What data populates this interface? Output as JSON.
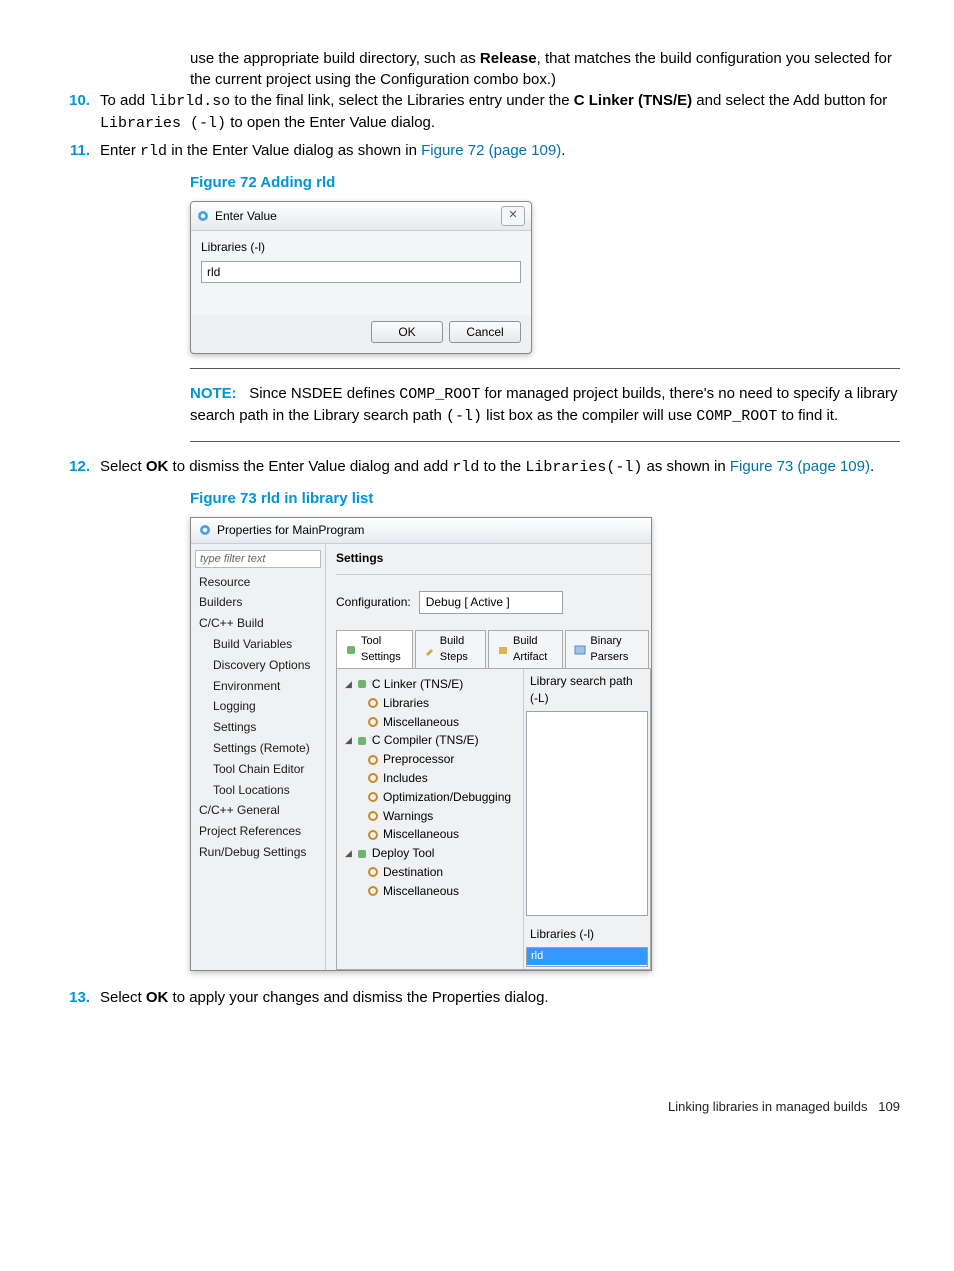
{
  "para0": {
    "pre": "use the appropriate build directory, such as ",
    "bold": "Release",
    "post": ", that matches the build configuration you selected for the current project using the Configuration combo box.)"
  },
  "step10": {
    "num": "10.",
    "t1": "To add ",
    "code1": "librld.so",
    "t2": " to the final link, select the Libraries entry under the ",
    "bold1": "C Linker (TNS/E)",
    "t3": " and select the Add button for ",
    "code2": "Libraries (-l)",
    "t4": " to open the Enter Value dialog."
  },
  "step11": {
    "num": "11.",
    "t1": "Enter ",
    "code1": "rld",
    "t2": " in the Enter Value dialog as shown in ",
    "link": "Figure 72 (page 109)",
    "t3": "."
  },
  "fig72": {
    "title": "Figure 72 Adding rld",
    "dlg_title": "Enter Value",
    "field_label": "Libraries (-l)",
    "value": "rld",
    "ok": "OK",
    "cancel": "Cancel"
  },
  "note": {
    "label": "NOTE:",
    "t1": "Since NSDEE defines ",
    "code1": "COMP_ROOT",
    "t2": " for managed project builds, there's no need to specify a library search path in the Library search path ",
    "code2": "(-l)",
    "t3": " list box as the compiler will use ",
    "code3": "COMP_ROOT",
    "t4": " to find it."
  },
  "step12": {
    "num": "12.",
    "t1": "Select ",
    "bold1": "OK",
    "t2": " to dismiss the Enter Value dialog and add ",
    "code1": "rld",
    "t3": " to the ",
    "code2": "Libraries(-l)",
    "t4": " as shown in ",
    "link": "Figure 73 (page 109)",
    "t5": "."
  },
  "fig73": {
    "title": "Figure 73 rld in library list",
    "dlg_title": "Properties for MainProgram",
    "filter_ph": "type filter text",
    "nav": {
      "resource": "Resource",
      "builders": "Builders",
      "ccbuild": "C/C++ Build",
      "buildvars": "Build Variables",
      "discovery": "Discovery Options",
      "environment": "Environment",
      "logging": "Logging",
      "settings": "Settings",
      "settings_remote": "Settings (Remote)",
      "toolchain": "Tool Chain Editor",
      "toollocations": "Tool Locations",
      "ccgeneral": "C/C++ General",
      "projrefs": "Project References",
      "rundebug": "Run/Debug Settings"
    },
    "heading": "Settings",
    "config_label": "Configuration:",
    "config_value": "Debug  [ Active ]",
    "tabs": {
      "tool_settings": "Tool Settings",
      "build_steps": "Build Steps",
      "build_artifact": "Build Artifact",
      "binary_parsers": "Binary Parsers"
    },
    "tree": {
      "clinker": "C Linker (TNS/E)",
      "libraries": "Libraries",
      "misc1": "Miscellaneous",
      "ccompiler": "C Compiler (TNS/E)",
      "preproc": "Preprocessor",
      "includes": "Includes",
      "optdebug": "Optimization/Debugging",
      "warnings": "Warnings",
      "misc2": "Miscellaneous",
      "deploy": "Deploy Tool",
      "dest": "Destination",
      "misc3": "Miscellaneous"
    },
    "libsearch": "Library search path (-L)",
    "liblist_label": "Libraries (-l)",
    "liblist_item": "rld"
  },
  "step13": {
    "num": "13.",
    "t1": "Select ",
    "bold1": "OK",
    "t2": " to apply your changes and dismiss the Properties dialog."
  },
  "footer": {
    "text": "Linking libraries in managed builds",
    "page": "109"
  }
}
